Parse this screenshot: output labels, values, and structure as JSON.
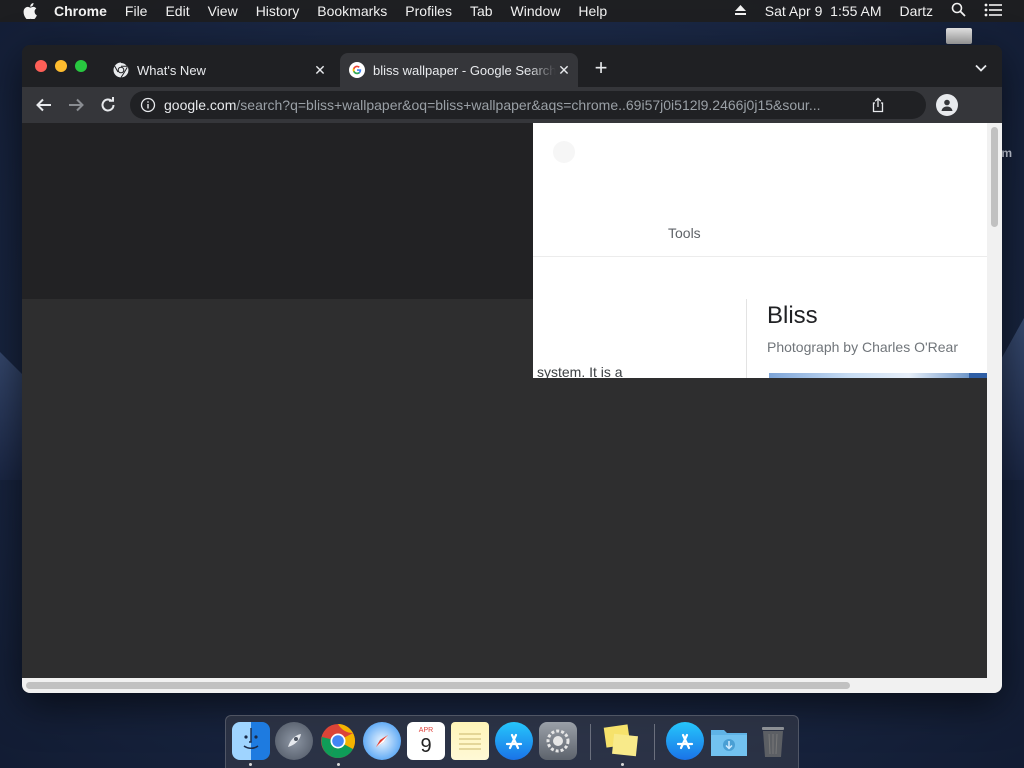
{
  "menubar": {
    "app_name": "Chrome",
    "items": [
      "File",
      "Edit",
      "View",
      "History",
      "Bookmarks",
      "Profiles",
      "Tab",
      "Window",
      "Help"
    ],
    "clock": "Sat Apr 9  1:55 AM",
    "user": "Dartz"
  },
  "desktop": {
    "edge_text": "m"
  },
  "browser": {
    "tabs": [
      {
        "title": "What's New",
        "icon": "chrome-icon",
        "active": false
      },
      {
        "title": "bliss wallpaper - Google Search",
        "icon": "google-g-icon",
        "active": true
      }
    ],
    "omnibox": {
      "domain": "google.com",
      "path": "/search?q=bliss+wallpaper&oq=bliss+wallpaper&aqs=chrome..69i57j0i512l9.2466j0j15&sour..."
    }
  },
  "page": {
    "tools_label": "Tools",
    "knowledge_panel": {
      "title": "Bliss",
      "subtitle": "Photograph by Charles O'Rear"
    },
    "snippet": "system. It is a"
  },
  "dock": {
    "apps": [
      "finder",
      "launchpad",
      "chrome",
      "safari",
      "calendar",
      "notes",
      "app-store",
      "system-preferences",
      "stickies",
      "app-store-folder",
      "downloads-folder",
      "trash"
    ],
    "calendar_month": "APR",
    "calendar_day": "9"
  },
  "colors": {
    "tab_active_bg": "#35363a",
    "tabstrip_bg": "#1f2023",
    "omnibox_bg": "#202124",
    "traffic_red": "#fe5f57",
    "traffic_yellow": "#febc2e",
    "traffic_green": "#28c840"
  }
}
